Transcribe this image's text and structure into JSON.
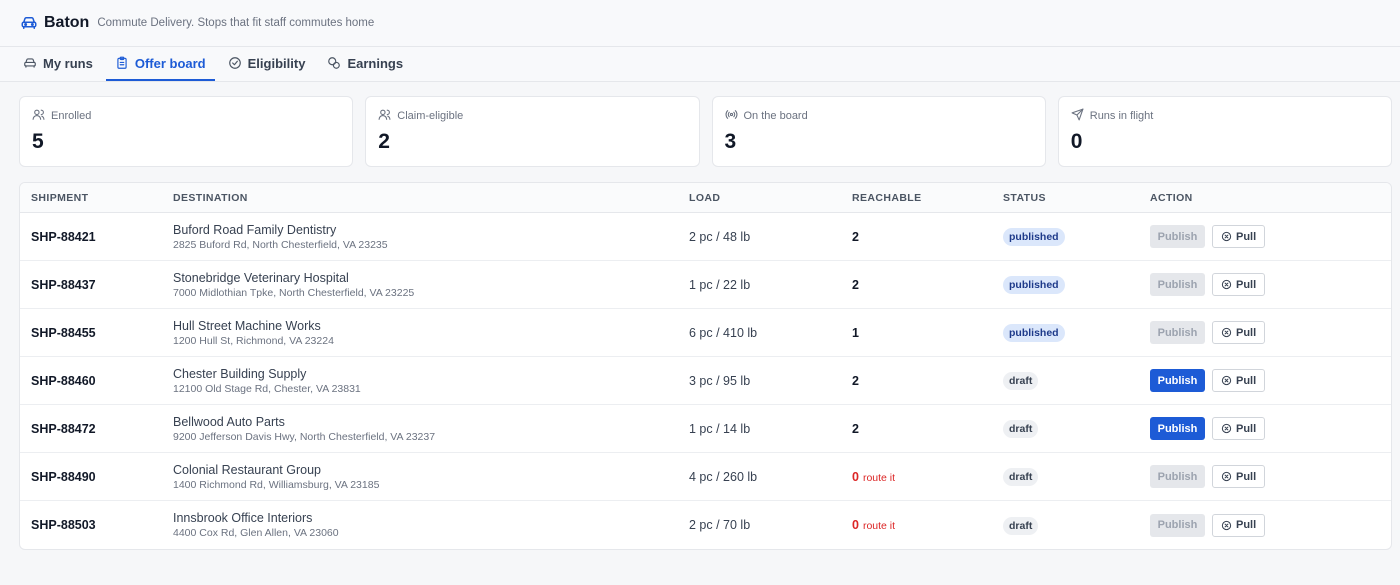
{
  "app": {
    "name": "Baton",
    "tagline": "Commute Delivery. Stops that fit staff commutes home"
  },
  "tabs": [
    {
      "label": "My runs",
      "icon": "car-icon",
      "active": false
    },
    {
      "label": "Offer board",
      "icon": "clipboard-icon",
      "active": true
    },
    {
      "label": "Eligibility",
      "icon": "check-circle-icon",
      "active": false
    },
    {
      "label": "Earnings",
      "icon": "coins-icon",
      "active": false
    }
  ],
  "stats": [
    {
      "label": "Enrolled",
      "value": "5",
      "icon": "users-icon"
    },
    {
      "label": "Claim-eligible",
      "value": "2",
      "icon": "users-icon"
    },
    {
      "label": "On the board",
      "value": "3",
      "icon": "broadcast-icon"
    },
    {
      "label": "Runs in flight",
      "value": "0",
      "icon": "send-icon"
    }
  ],
  "table": {
    "headers": [
      "SHIPMENT",
      "DESTINATION",
      "LOAD",
      "REACHABLE",
      "STATUS",
      "ACTION"
    ],
    "rows": [
      {
        "shipment": "SHP-88421",
        "dest_name": "Buford Road Family Dentistry",
        "dest_addr": "2825 Buford Rd, North Chesterfield, VA 23235",
        "load": "2 pc / 48 lb",
        "reachable": "2",
        "reach_note": "",
        "status": "published",
        "publish_label": "Publish",
        "publish_enabled": false,
        "pull_label": "Pull"
      },
      {
        "shipment": "SHP-88437",
        "dest_name": "Stonebridge Veterinary Hospital",
        "dest_addr": "7000 Midlothian Tpke, North Chesterfield, VA 23225",
        "load": "1 pc / 22 lb",
        "reachable": "2",
        "reach_note": "",
        "status": "published",
        "publish_label": "Publish",
        "publish_enabled": false,
        "pull_label": "Pull"
      },
      {
        "shipment": "SHP-88455",
        "dest_name": "Hull Street Machine Works",
        "dest_addr": "1200 Hull St, Richmond, VA 23224",
        "load": "6 pc / 410 lb",
        "reachable": "1",
        "reach_note": "",
        "status": "published",
        "publish_label": "Publish",
        "publish_enabled": false,
        "pull_label": "Pull"
      },
      {
        "shipment": "SHP-88460",
        "dest_name": "Chester Building Supply",
        "dest_addr": "12100 Old Stage Rd, Chester, VA 23831",
        "load": "3 pc / 95 lb",
        "reachable": "2",
        "reach_note": "",
        "status": "draft",
        "publish_label": "Publish",
        "publish_enabled": true,
        "pull_label": "Pull"
      },
      {
        "shipment": "SHP-88472",
        "dest_name": "Bellwood Auto Parts",
        "dest_addr": "9200 Jefferson Davis Hwy, North Chesterfield, VA 23237",
        "load": "1 pc / 14 lb",
        "reachable": "2",
        "reach_note": "",
        "status": "draft",
        "publish_label": "Publish",
        "publish_enabled": true,
        "pull_label": "Pull"
      },
      {
        "shipment": "SHP-88490",
        "dest_name": "Colonial Restaurant Group",
        "dest_addr": "1400 Richmond Rd, Williamsburg, VA 23185",
        "load": "4 pc / 260 lb",
        "reachable": "0",
        "reach_note": "route it",
        "status": "draft",
        "publish_label": "Publish",
        "publish_enabled": false,
        "pull_label": "Pull"
      },
      {
        "shipment": "SHP-88503",
        "dest_name": "Innsbrook Office Interiors",
        "dest_addr": "4400 Cox Rd, Glen Allen, VA 23060",
        "load": "2 pc / 70 lb",
        "reachable": "0",
        "reach_note": "route it",
        "status": "draft",
        "publish_label": "Publish",
        "publish_enabled": false,
        "pull_label": "Pull"
      }
    ]
  },
  "colors": {
    "accent": "#1d5bd6",
    "danger": "#dc2626",
    "published_bg": "#dbe7fb",
    "draft_bg": "#eef0f3"
  }
}
